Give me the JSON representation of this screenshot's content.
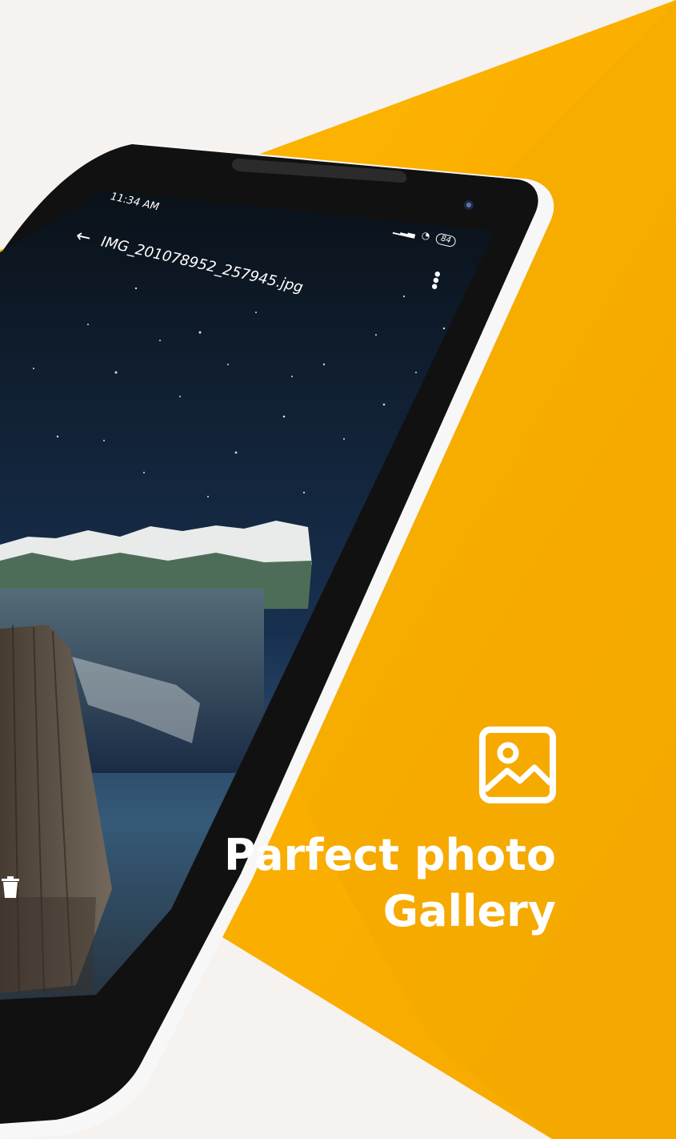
{
  "phone": {
    "status_time": "11:34 AM",
    "battery": "84",
    "file_name": "IMG_201078952_257945.jpg",
    "back_icon": "arrow-left-icon",
    "menu_icon": "vertical-dots-icon",
    "delete_icon": "trash-icon"
  },
  "promo": {
    "icon": "photo-icon",
    "line1": "Parfect photo",
    "line2": "Gallery"
  },
  "colors": {
    "background": "#f5f2ef",
    "accent": "#f5a800",
    "text_light": "#ffffff",
    "phone_body": "#111111"
  }
}
